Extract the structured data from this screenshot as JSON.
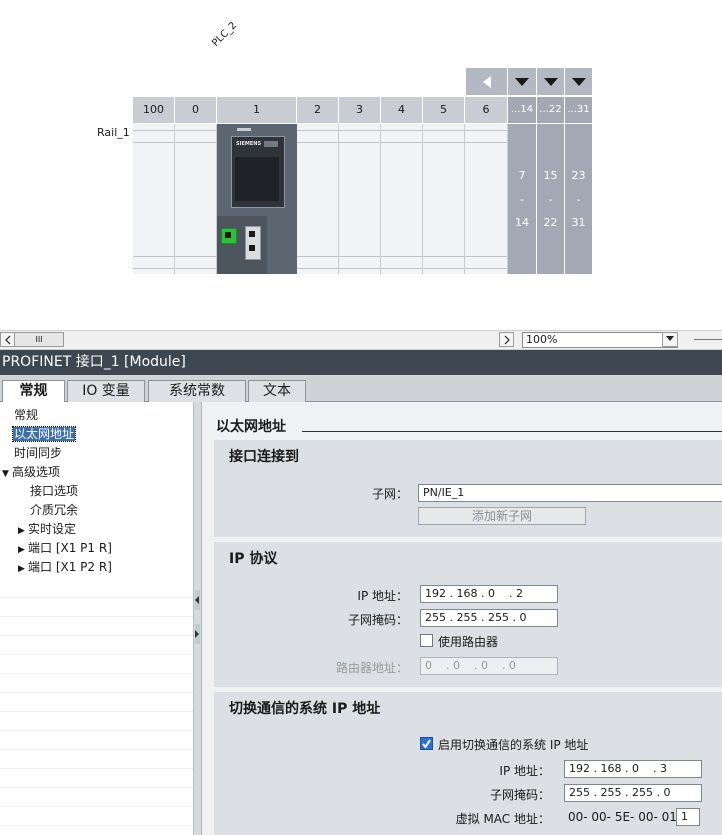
{
  "rack": {
    "device_label": "PLC_2",
    "rail_label": "Rail_1",
    "slots": [
      "100",
      "0",
      "1",
      "2",
      "3",
      "4",
      "5",
      "6"
    ],
    "ext_slots": [
      {
        "head": "...14",
        "from": "7",
        "dash": "-",
        "to": "14"
      },
      {
        "head": "...22",
        "from": "15",
        "dash": "-",
        "to": "22"
      },
      {
        "head": "...31",
        "from": "23",
        "dash": "-",
        "to": "31"
      }
    ],
    "cpu_brand": "SIEMENS"
  },
  "scrollbar": {
    "grip": "III",
    "zoom": "100%"
  },
  "inspector": {
    "title": "PROFINET 接口_1 [Module]",
    "tabs": [
      "常规",
      "IO 变量",
      "系统常数",
      "文本"
    ],
    "nav": {
      "items": [
        "常规",
        "以太网地址",
        "时间同步",
        "高级选项",
        "接口选项",
        "介质冗余",
        "实时设定",
        "端口 [X1 P1 R]",
        "端口 [X1 P2 R]"
      ]
    },
    "content": {
      "header": "以太网地址",
      "interface_section": {
        "title": "接口连接到",
        "subnet_label": "子网：",
        "subnet_value": "PN/IE_1",
        "add_subnet_button": "添加新子网"
      },
      "ip_section": {
        "title": "IP 协议",
        "ip_label": "IP 地址：",
        "ip_value": "192 . 168 . 0    . 2",
        "mask_label": "子网掩码：",
        "mask_value": "255 . 255 . 255 . 0",
        "router_checkbox_label": "使用路由器",
        "router_checked": false,
        "router_label": "路由器地址：",
        "router_value": "0    . 0    . 0    . 0"
      },
      "switch_section": {
        "title": "切换通信的系统 IP 地址",
        "enable_label": "启用切换通信的系统 IP 地址",
        "enable_checked": true,
        "ip_label": "IP 地址：",
        "ip_value": "192 . 168 . 0    . 3",
        "mask_label": "子网掩码：",
        "mask_value": "255 . 255 . 255 . 0",
        "mac_label": "虚拟 MAC 地址：",
        "mac_prefix": "00- 00- 5E- 00- 01-",
        "mac_last": "1"
      }
    }
  }
}
